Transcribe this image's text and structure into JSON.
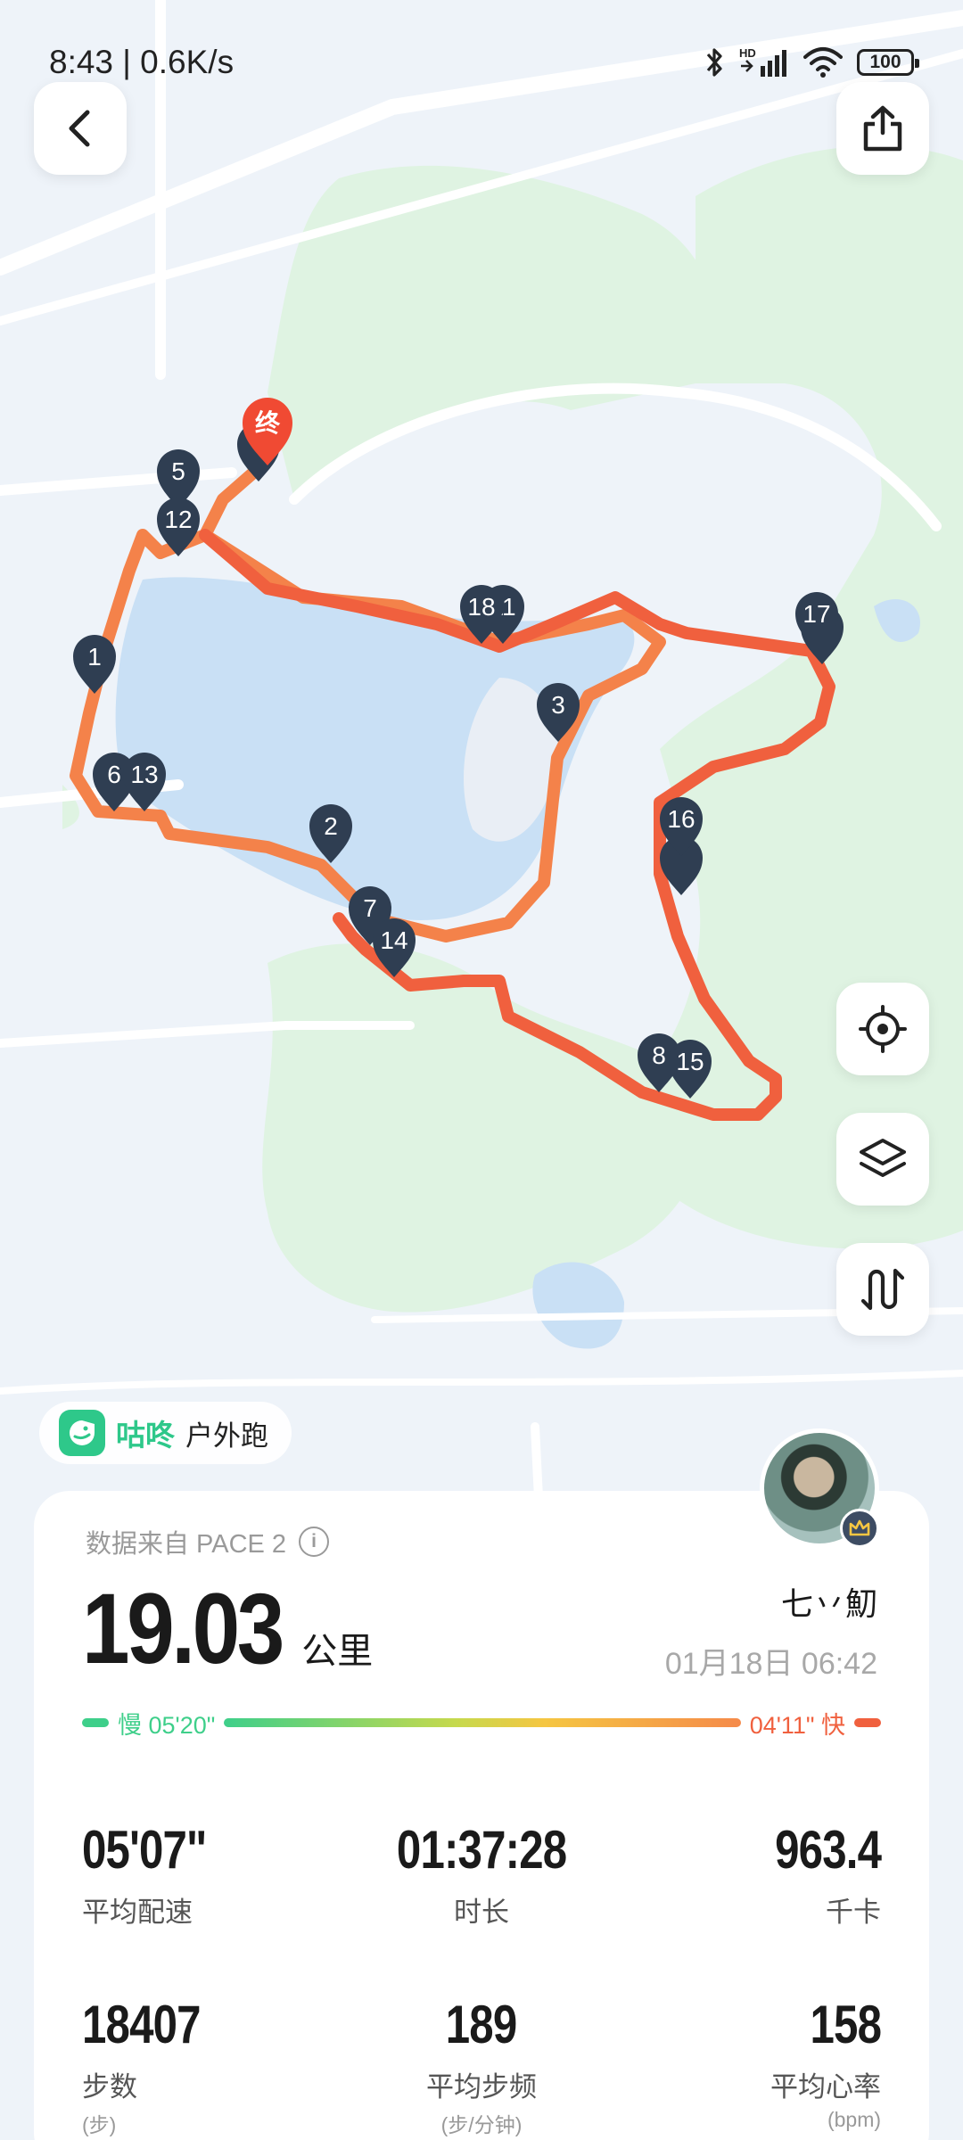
{
  "status_bar": {
    "time": "8:43 | 0.6K/s",
    "network": "HD",
    "battery": "100"
  },
  "map": {
    "end_marker_label": "终",
    "km_markers": [
      "1",
      "2",
      "3",
      "5",
      "6",
      "7",
      "8",
      "11",
      "12",
      "13",
      "14",
      "15",
      "16",
      "17",
      "18"
    ],
    "colors": {
      "route": "#f0603e",
      "route_alt": "#f4824a",
      "marker": "#2f3e52",
      "end": "#f04a33"
    }
  },
  "app": {
    "name": "咕咚",
    "activity_type": "户外跑"
  },
  "summary": {
    "source_text": "数据来自 PACE 2",
    "distance_value": "19.03",
    "distance_unit": "公里",
    "username": "七丷魛",
    "datetime": "01月18日 06:42"
  },
  "pace_legend": {
    "slow_label": "慢 05'20\"",
    "fast_label": "04'11\" 快",
    "slow_color": "#3ecf8a",
    "fast_color": "#f0603e"
  },
  "stats": [
    {
      "value": "05'07\"",
      "label": "平均配速",
      "sub": ""
    },
    {
      "value": "01:37:28",
      "label": "时长",
      "sub": ""
    },
    {
      "value": "963.4",
      "label": "千卡",
      "sub": ""
    },
    {
      "value": "18407",
      "label": "步数",
      "sub": "(步)"
    },
    {
      "value": "189",
      "label": "平均步频",
      "sub": "(步/分钟)"
    },
    {
      "value": "158",
      "label": "平均心率",
      "sub": "(bpm)"
    }
  ],
  "icons": [
    "back-icon",
    "share-icon",
    "locate-icon",
    "layers-icon",
    "route-toggle-icon",
    "info-icon",
    "crown-icon",
    "bluetooth-icon",
    "signal-icon",
    "wifi-icon"
  ]
}
